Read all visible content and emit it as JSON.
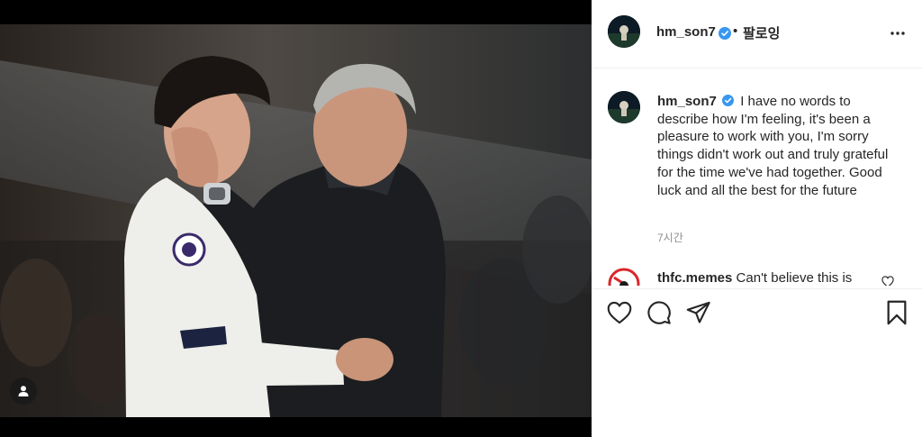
{
  "post": {
    "author": "hm_son7",
    "follow_separator": "•",
    "follow_label": "팔로잉",
    "caption": "I have no words to describe how I'm feeling, it's been a pleasure to work with you, I'm sorry things didn't work out and truly grateful for the time we've had together. Good luck and all the best for the future",
    "time_ago": "7시간"
  },
  "comment": {
    "author": "thfc.memes",
    "text": "Can't believe this is"
  },
  "colors": {
    "verified": "#3897f0",
    "text": "#262626",
    "muted": "#8e8e8e",
    "divider": "#efefef"
  },
  "icons": [
    "user-tag-icon",
    "verified-badge-icon",
    "more-options-icon",
    "heart-icon",
    "comment-icon",
    "share-icon",
    "bookmark-icon",
    "small-heart-icon"
  ]
}
